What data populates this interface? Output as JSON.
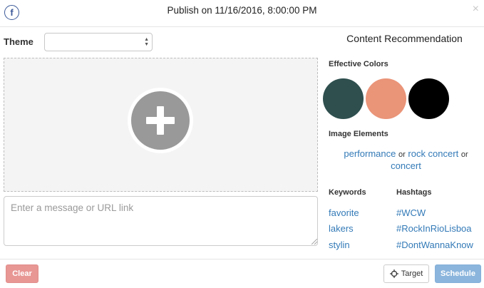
{
  "header": {
    "network_icon": "facebook-icon",
    "network_glyph": "f",
    "title": "Publish on 11/16/2016, 8:00:00 PM",
    "close_icon": "close-icon",
    "close_glyph": "×"
  },
  "composer": {
    "theme_label": "Theme",
    "theme_selected": "",
    "upload_icon": "plus-icon",
    "message_placeholder": "Enter a message or URL link",
    "message_value": ""
  },
  "recommendation": {
    "title": "Content Recommendation",
    "effective_colors_label": "Effective Colors",
    "colors": [
      "#2e4f4e",
      "#ea9478",
      "#000000"
    ],
    "image_elements_label": "Image Elements",
    "image_elements": [
      "performance",
      "rock concert",
      "concert"
    ],
    "connector": "or",
    "keywords_label": "Keywords",
    "keywords": [
      "favorite",
      "lakers",
      "stylin"
    ],
    "hashtags_label": "Hashtags",
    "hashtags": [
      "#WCW",
      "#RockInRioLisboa",
      "#DontWannaKnow"
    ]
  },
  "footer": {
    "clear_label": "Clear",
    "target_label": "Target",
    "target_icon": "crosshair-icon",
    "schedule_label": "Schedule"
  },
  "colors": {
    "facebook": "#3b5998",
    "link": "#337ab7",
    "clear_button": "#e89795",
    "schedule_button": "#8bb5dc"
  }
}
